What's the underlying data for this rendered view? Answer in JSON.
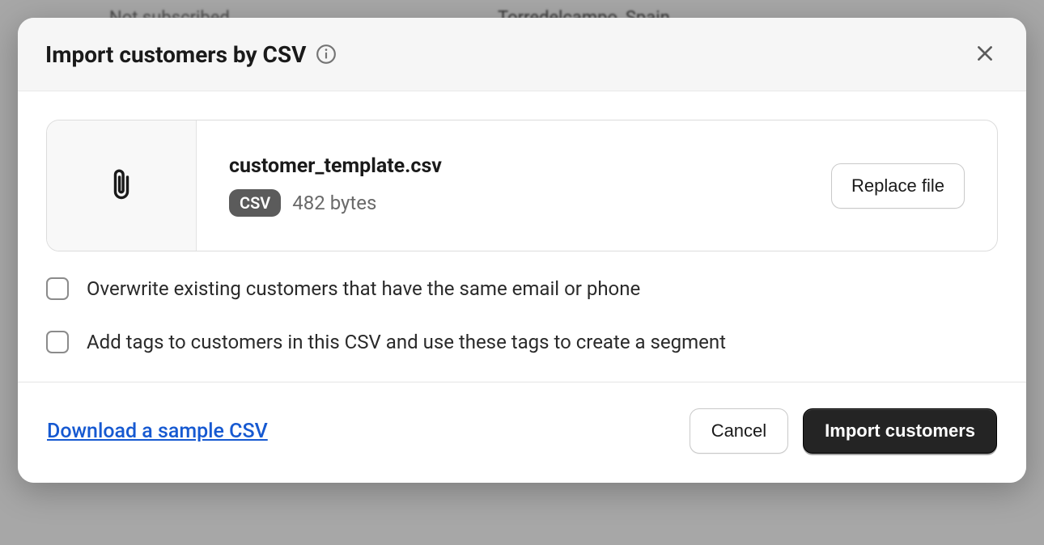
{
  "background": {
    "badge_text": "Not subscribed",
    "location_text": "Torredelcampo, Spain"
  },
  "modal": {
    "title": "Import customers by CSV",
    "file": {
      "name": "customer_template.csv",
      "type_badge": "CSV",
      "size": "482 bytes",
      "replace_label": "Replace file"
    },
    "checkboxes": [
      {
        "label": "Overwrite existing customers that have the same email or phone",
        "checked": false
      },
      {
        "label": "Add tags to customers in this CSV and use these tags to create a segment",
        "checked": false
      }
    ],
    "footer": {
      "download_link": "Download a sample CSV",
      "cancel_label": "Cancel",
      "import_label": "Import customers"
    }
  }
}
